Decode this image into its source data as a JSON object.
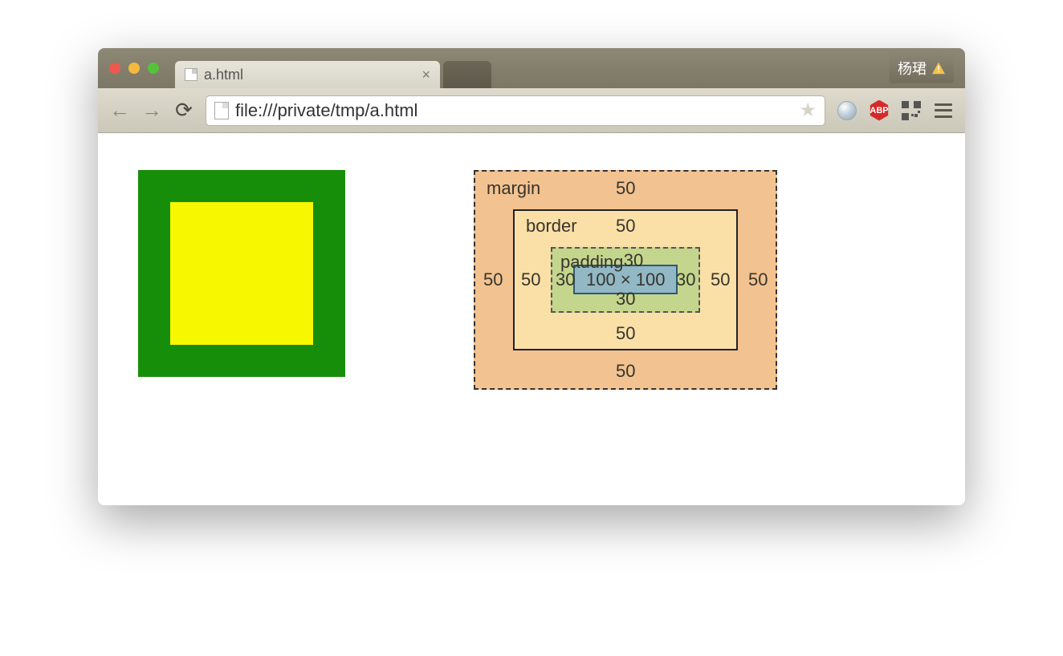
{
  "window": {
    "tab_title": "a.html",
    "user_label": "杨珺",
    "url_text": "file:///private/tmp/a.html"
  },
  "boxmodel": {
    "margin_label": "margin",
    "border_label": "border",
    "padding_label": "padding",
    "margin_top": "50",
    "margin_right": "50",
    "margin_bottom": "50",
    "margin_left": "50",
    "border_top": "50",
    "border_right": "50",
    "border_bottom": "50",
    "border_left": "50",
    "padding_top": "30",
    "padding_right": "30",
    "padding_bottom": "30",
    "padding_left": "30",
    "content_dims": "100 × 100"
  }
}
